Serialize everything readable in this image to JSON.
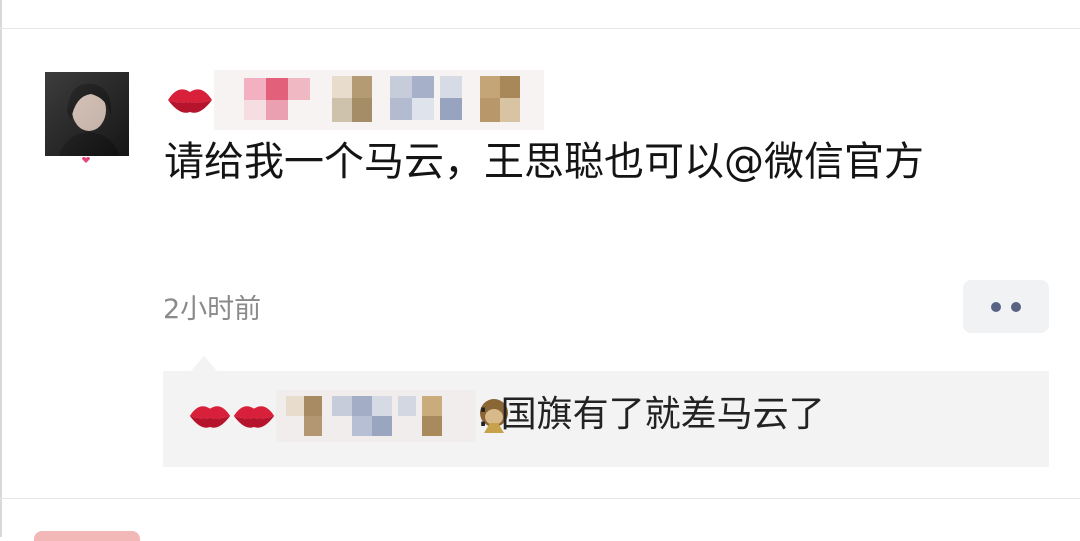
{
  "comment": {
    "text": "请给我一个马云，王思聪也可以@微信官方",
    "time": "2小时前"
  },
  "reply": {
    "separator": ":",
    "text": "国旗有了就差马云了"
  },
  "more_button": {
    "icon": "more-dots-icon"
  },
  "colors": {
    "divider": "#e6e6e6",
    "reply_bg": "#f3f3f3",
    "timestamp": "#8a8a8a",
    "more_dots": "#596384"
  }
}
